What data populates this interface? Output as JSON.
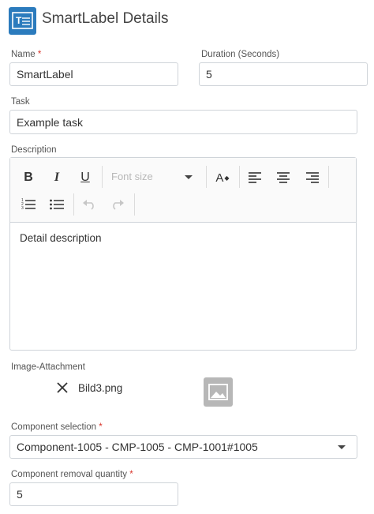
{
  "header": {
    "title": "SmartLabel Details",
    "icon": "smartlabel-icon"
  },
  "fields": {
    "name": {
      "label": "Name",
      "required_mark": "*",
      "value": "SmartLabel"
    },
    "duration": {
      "label": "Duration (Seconds)",
      "value": "5"
    },
    "task": {
      "label": "Task",
      "value": "Example task"
    },
    "description": {
      "label": "Description",
      "content": "Detail description",
      "toolbar": {
        "bold": "B",
        "italic": "I",
        "underline": "U",
        "font_size_placeholder": "Font size",
        "text_color": "A"
      }
    },
    "image_attachment": {
      "label": "Image-Attachment",
      "filename": "Bild3.png"
    },
    "component_selection": {
      "label": "Component selection",
      "required_mark": "*",
      "value": "Component-1005 - CMP-1005 - CMP-1001#1005"
    },
    "removal_quantity": {
      "label": "Component removal quantity",
      "required_mark": "*",
      "value": "5"
    }
  },
  "colors": {
    "accent": "#2b7bbd",
    "required": "#d9342b",
    "border": "#cfd4d9"
  }
}
